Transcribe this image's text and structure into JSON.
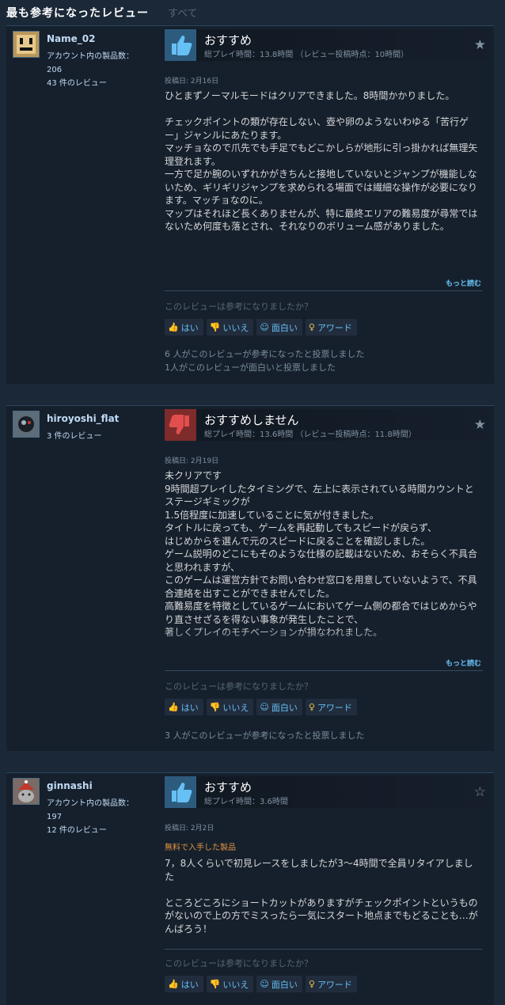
{
  "header": {
    "active_tab": "最も参考になったレビュー",
    "all_tab": "すべて"
  },
  "colors": {
    "accent": "#66c0f4",
    "background": "#1b2838",
    "card": "#16202d",
    "recommended": "#2d5b7e",
    "not_recommended": "#7e2b2b"
  },
  "reviews": [
    {
      "author": "Name_02",
      "products_label": "アカウント内の製品数：",
      "products_count": "206",
      "reviews_count": "43 件のレビュー",
      "verdict": "おすすめ",
      "verdict_icon": "thumbs-up-icon",
      "playtime": "総プレイ時間：13.8時間 （レビュー投稿時点：10時間）",
      "posted": "投稿日: 2月16日",
      "body": "ひとまずノーマルモードはクリアできました。8時間かかりました。\n\nチェックポイントの類が存在しない、壺や卵のようないわゆる「苦行ゲー」ジャンルにあたります。\nマッチョなので爪先でも手足でもどこかしらが地形に引っ掛かれば無理矢理登れます。\n一方で足か腕のいずれかがきちんと接地していないとジャンプが機能しないため、ギリギリジャンプを求められる場面では繊細な操作が必要になります。マッチョなのに。\nマップはそれほど長くありませんが、特に最終エリアの難易度が尋常ではないため何度も落とされ、それなりのボリューム感がありました。",
      "read_more": "もっと読む",
      "helpful_question": "このレビューは参考になりましたか？",
      "buttons": {
        "yes": "はい",
        "no": "いいえ",
        "funny": "面白い",
        "award": "アワード"
      },
      "votes": [
        "6 人がこのレビューが参考になったと投票しました",
        "1人がこのレビューが面白いと投票しました"
      ]
    },
    {
      "author": "hiroyoshi_flat",
      "reviews_count": "3 件のレビュー",
      "verdict": "おすすめしません",
      "verdict_icon": "thumbs-down-icon",
      "playtime": "総プレイ時間：13.6時間 （レビュー投稿時点：11.8時間）",
      "posted": "投稿日: 2月19日",
      "body": "未クリアです\n9時間超プレイしたタイミングで、左上に表示されている時間カウントとステージギミックが\n1.5倍程度に加速していることに気が付きました。\nタイトルに戻っても、ゲームを再起動してもスピードが戻らず、\nはじめからを選んで元のスピードに戻ることを確認しました。\nゲーム説明のどこにもそのような仕様の記載はないため、おそらく不具合と思われますが、\nこのゲームは運営方針でお問い合わせ窓口を用意していないようで、不具合連絡を出すことができませんでした。\n高難易度を特徴としているゲームにおいてゲーム側の都合ではじめからやり直させざるを得ない事象が発生したことで、\n著しくプレイのモチベーションが損なわれました。",
      "read_more": "もっと読む",
      "helpful_question": "このレビューは参考になりましたか？",
      "buttons": {
        "yes": "はい",
        "no": "いいえ",
        "funny": "面白い",
        "award": "アワード"
      },
      "votes": [
        "3 人がこのレビューが参考になったと投票しました"
      ]
    },
    {
      "author": "ginnashi",
      "products_label": "アカウント内の製品数：",
      "products_count": "197",
      "reviews_count": "12 件のレビュー",
      "verdict": "おすすめ",
      "verdict_icon": "thumbs-up-icon",
      "playtime": "総プレイ時間：3.6時間",
      "posted": "投稿日: 2月2日",
      "free_label": "無料で入手した製品",
      "body": "7，8人くらいで初見レースをしましたが3～4時間で全員リタイアしました\n\nところどころにショートカットがありますがチェックポイントというものがないので上の方でミスったら一気にスタート地点までもどることも…がんばろう！",
      "helpful_question": "このレビューは参考になりましたか？",
      "buttons": {
        "yes": "はい",
        "no": "いいえ",
        "funny": "面白い",
        "award": "アワード"
      }
    }
  ]
}
